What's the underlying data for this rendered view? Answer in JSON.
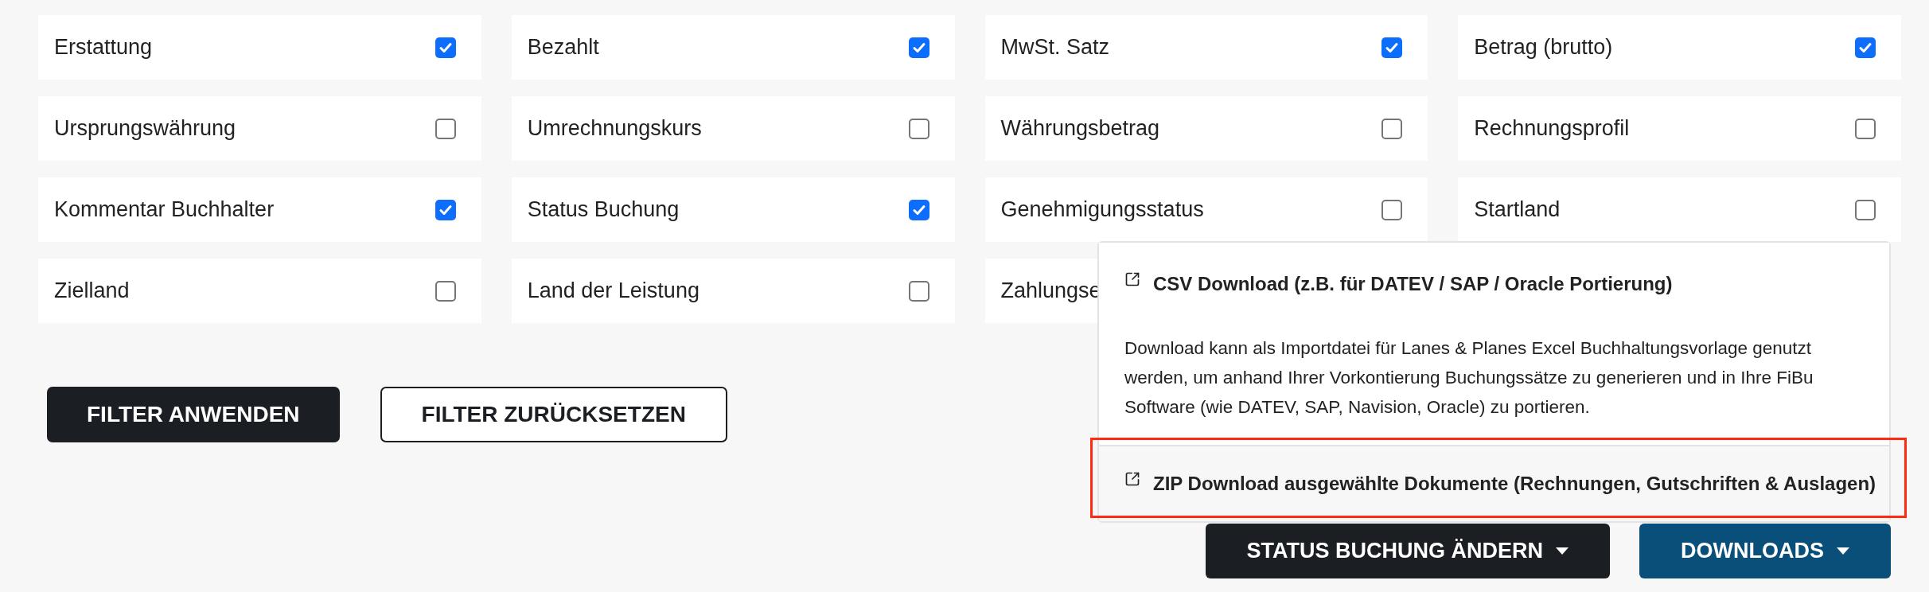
{
  "filters": [
    {
      "label": "Erstattung",
      "checked": true
    },
    {
      "label": "Bezahlt",
      "checked": true
    },
    {
      "label": "MwSt. Satz",
      "checked": true
    },
    {
      "label": "Betrag (brutto)",
      "checked": true
    },
    {
      "label": "Ursprungswährung",
      "checked": false
    },
    {
      "label": "Umrechnungskurs",
      "checked": false
    },
    {
      "label": "Währungsbetrag",
      "checked": false
    },
    {
      "label": "Rechnungsprofil",
      "checked": false
    },
    {
      "label": "Kommentar Buchhalter",
      "checked": true
    },
    {
      "label": "Status Buchung",
      "checked": true
    },
    {
      "label": "Genehmigungsstatus",
      "checked": false
    },
    {
      "label": "Startland",
      "checked": false
    },
    {
      "label": "Zielland",
      "checked": false
    },
    {
      "label": "Land der Leistung",
      "checked": false
    },
    {
      "label": "Zahlungse"
    }
  ],
  "filter_buttons": [
    {
      "label": "FILTER ANWENDEN",
      "kind": "primary"
    },
    {
      "label": "FILTER ZURÜCKSETZEN",
      "kind": "outline"
    }
  ],
  "downloads_menu": {
    "items": [
      {
        "title": "CSV Download (z.B. für DATEV / SAP / Oracle Portierung)",
        "description": "Download kann als Importdatei für Lanes & Planes Excel Buchhaltungsvorlage genutzt werden, um anhand Ihrer Vorkontierung Buchungssätze zu generieren und in Ihre FiBu Software (wie DATEV, SAP, Navision, Oracle) zu portieren.",
        "highlighted": false
      },
      {
        "title": "ZIP Download ausgewählte Dokumente (Rechnungen, Gutschriften & Auslagen)",
        "highlighted": true
      }
    ]
  },
  "action_buttons": [
    {
      "label": "STATUS BUCHUNG ÄNDERN",
      "kind": "dark"
    },
    {
      "label": "DOWNLOADS",
      "kind": "blue"
    }
  ]
}
